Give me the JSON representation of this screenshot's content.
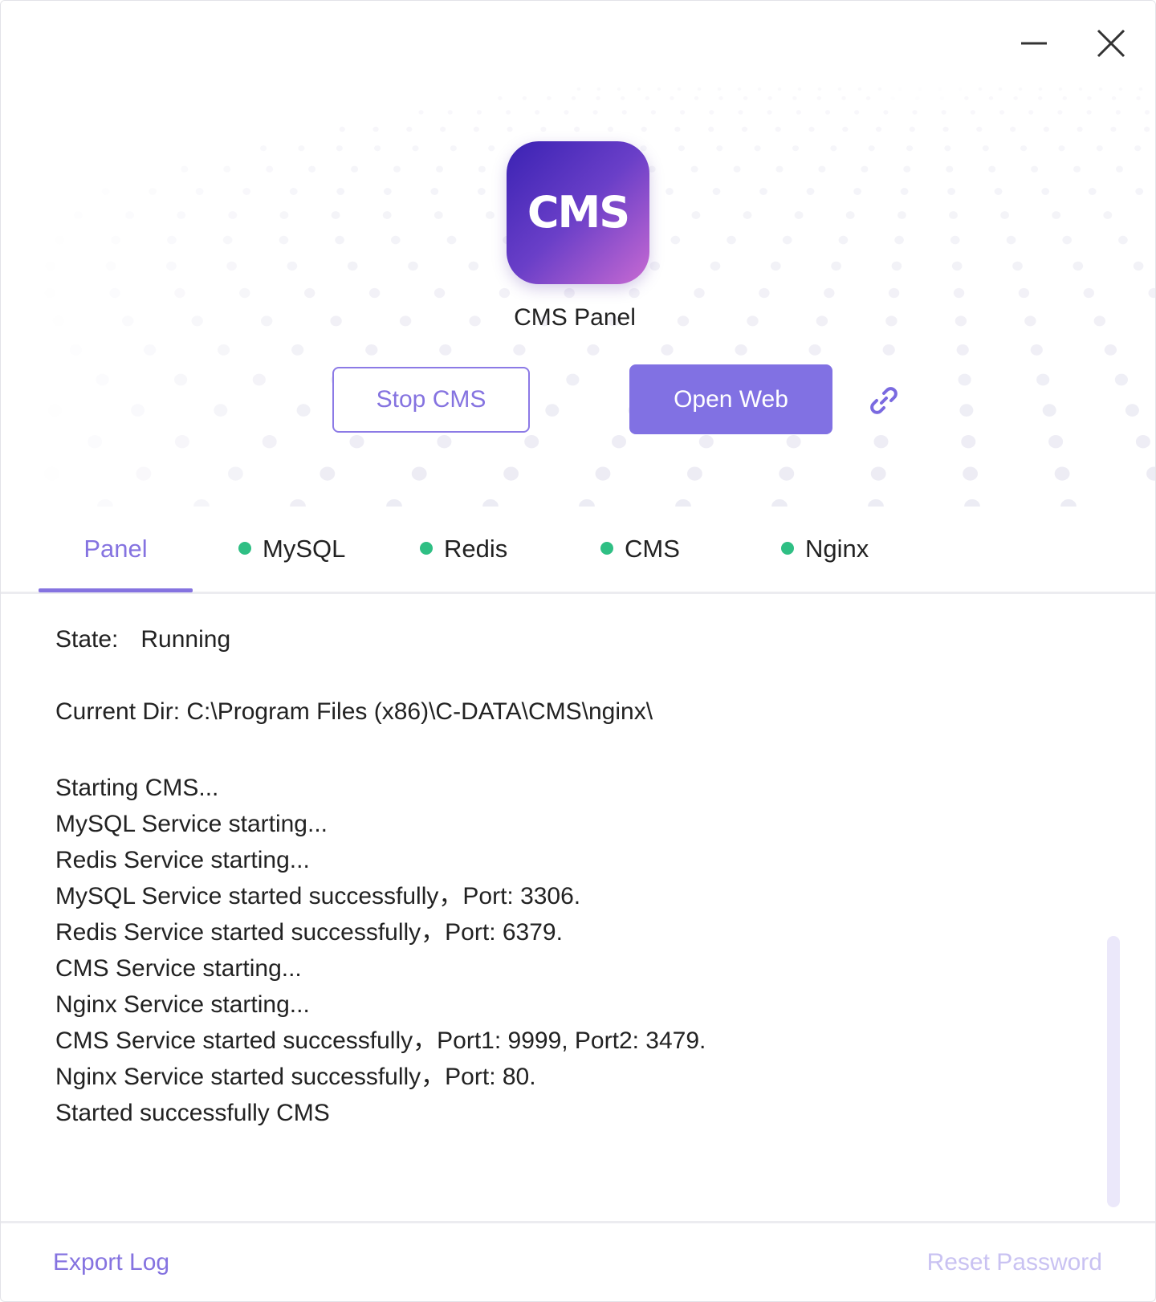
{
  "window": {
    "minimize_icon": "minimize-icon",
    "close_icon": "close-icon"
  },
  "header": {
    "logo_text": "CMS",
    "app_name": "CMS Panel",
    "stop_button_label": "Stop CMS",
    "open_web_button_label": "Open Web",
    "link_icon": "link-icon"
  },
  "tabs": [
    {
      "label": "Panel",
      "active": true,
      "status": null
    },
    {
      "label": "MySQL",
      "active": false,
      "status": "running"
    },
    {
      "label": "Redis",
      "active": false,
      "status": "running"
    },
    {
      "label": "CMS",
      "active": false,
      "status": "running"
    },
    {
      "label": "Nginx",
      "active": false,
      "status": "running"
    }
  ],
  "panel": {
    "state_label": "State:",
    "state_value": "Running",
    "current_dir": "Current Dir: C:\\Program Files (x86)\\C-DATA\\CMS\\nginx\\",
    "log": [
      "Starting CMS...",
      "MySQL Service starting...",
      "Redis Service starting...",
      "MySQL Service started successfully，Port: 3306.",
      "Redis Service started successfully，Port: 6379.",
      "CMS Service starting...",
      "Nginx Service starting...",
      "CMS Service started successfully，Port1: 9999, Port2: 3479.",
      "Nginx Service started successfully，Port: 80.",
      "Started successfully CMS"
    ]
  },
  "footer": {
    "export_log_label": "Export Log",
    "reset_password_label": "Reset Password"
  },
  "colors": {
    "accent": "#8573e0",
    "primary_button": "#8171e3",
    "status_running": "#2fbf84",
    "reset_password_disabled": "#c9c2f2"
  }
}
